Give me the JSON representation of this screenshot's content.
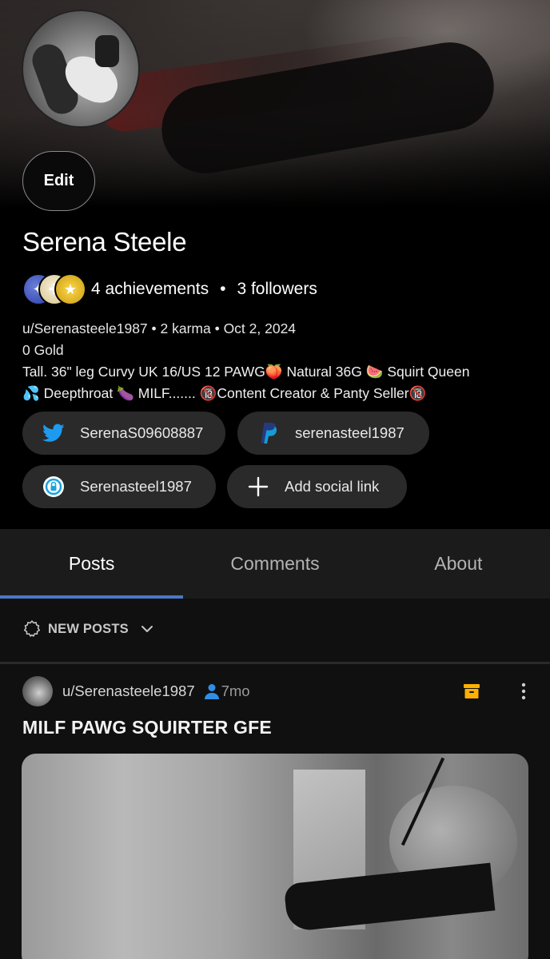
{
  "profile": {
    "edit_label": "Edit",
    "display_name": "Serena Steele",
    "achievements": "4 achievements",
    "separator": "•",
    "followers": "3 followers",
    "meta_line": "u/Serenasteele1987 • 2 karma • Oct 2, 2024",
    "gold": "0 Gold",
    "bio_line1": "Tall. 36\" leg Curvy UK 16/US 12 PAWG🍑 Natural 36G 🍉 Squirt Queen",
    "bio_line2": "💦 Deepthroat 🍆 MILF....... 🔞Content Creator & Panty Seller🔞"
  },
  "social_links": [
    {
      "label": "SerenaS09608887",
      "icon": "twitter-icon"
    },
    {
      "label": "serenasteel1987",
      "icon": "paypal-icon"
    },
    {
      "label": "Serenasteel1987",
      "icon": "onlyfans-icon"
    },
    {
      "label": "Add social link",
      "icon": "plus-icon"
    }
  ],
  "tabs": [
    {
      "label": "Posts",
      "active": true
    },
    {
      "label": "Comments",
      "active": false
    },
    {
      "label": "About",
      "active": false
    }
  ],
  "feed": {
    "sort_label": "NEW POSTS",
    "post": {
      "username": "u/Serenasteele1987",
      "time": "7mo",
      "title": "MILF PAWG SQUIRTER GFE"
    }
  },
  "colors": {
    "background": "#000000",
    "chip_bg": "#2a2a2a",
    "tab_bar_bg": "#1b1b1b",
    "active_tab_underline": "#4a78c8",
    "twitter": "#1d9bf0",
    "paypal_dark": "#253b80",
    "paypal_light": "#179bd7",
    "archive_icon": "#ffb000",
    "user_icon": "#2f8fe6"
  }
}
